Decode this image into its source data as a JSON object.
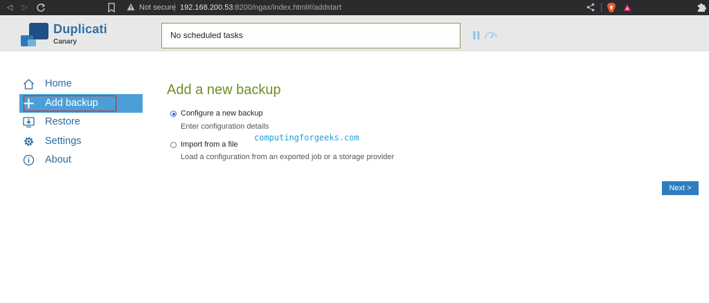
{
  "browser": {
    "not_secure": "Not secure",
    "url_host": "192.168.200.53",
    "url_rest": ":8200/ngax/index.html#/addstart"
  },
  "header": {
    "brand": "Duplicati",
    "edition": "Canary",
    "status": "No scheduled tasks"
  },
  "sidebar": {
    "items": [
      {
        "label": "Home",
        "icon": "home-icon"
      },
      {
        "label": "Add backup",
        "icon": "plus-icon"
      },
      {
        "label": "Restore",
        "icon": "restore-icon"
      },
      {
        "label": "Settings",
        "icon": "gear-icon"
      },
      {
        "label": "About",
        "icon": "info-icon"
      }
    ],
    "active_index": 1
  },
  "main": {
    "title": "Add a new backup",
    "options": [
      {
        "label": "Configure a new backup",
        "description": "Enter configuration details",
        "selected": true
      },
      {
        "label": "Import from a file",
        "description": "Load a configuration from an exported job or a storage provider",
        "selected": false
      }
    ],
    "watermark": "computingforgeeks.com",
    "next_label": "Next >"
  },
  "colors": {
    "accent": "#4a9fd8",
    "title": "#6b8e23",
    "link": "#2b6a9e",
    "button": "#2e7dbf"
  }
}
